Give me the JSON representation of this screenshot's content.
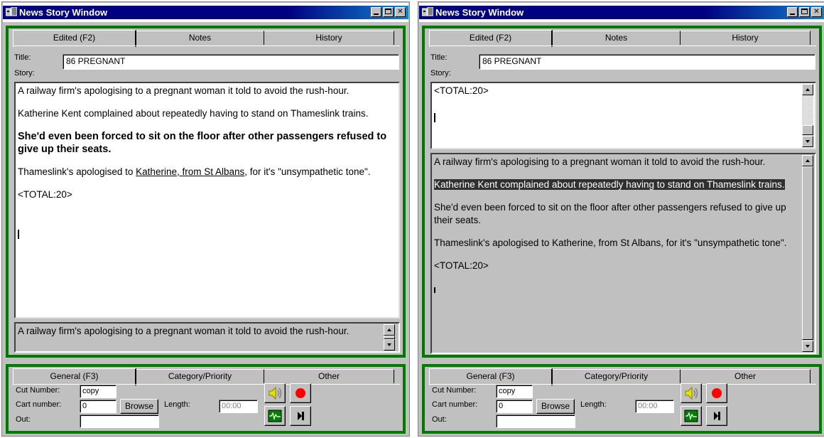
{
  "windows": [
    {
      "title": "News Story Window",
      "top_tabs": [
        "Edited (F2)",
        "Notes",
        "History"
      ],
      "title_label": "Title:",
      "title_value": "86 PREGNANT",
      "story_label": "Story:",
      "story": {
        "p1": "A railway firm's apologising to a pregnant woman it told to avoid the rush-hour.",
        "p2": "Katherine Kent complained about repeatedly having to stand on Thameslink trains.",
        "p3": "She'd even been forced to sit on the floor after other passengers refused to give up their seats.",
        "p4_pre": "Thameslink's apologised to ",
        "p4_link": "Katherine, from St Albans",
        "p4_post": ", for it's \"unsympathetic tone\".",
        "total": "<TOTAL:20>"
      },
      "preview": "A railway firm's apologising to a pregnant woman it told to avoid the rush-hour.",
      "bottom_tabs": [
        "General (F3)",
        "Category/Priority",
        "Other"
      ],
      "cut_number_label": "Cut Number:",
      "cut_number_value": "copy",
      "cart_number_label": "Cart number:",
      "cart_number_value": "0",
      "browse_label": "Browse",
      "length_label": "Length:",
      "length_value": "00:00",
      "out_label": "Out:"
    },
    {
      "title": "News Story Window",
      "top_tabs": [
        "Edited (F2)",
        "Notes",
        "History"
      ],
      "title_label": "Title:",
      "title_value": "86 PREGNANT",
      "story_label": "Story:",
      "editor_text": "<TOTAL:20>",
      "preview": {
        "p1": "A railway firm's apologising to a pregnant woman it told to avoid the rush-hour.",
        "p2": "Katherine Kent complained about repeatedly having to stand on Thameslink trains.",
        "p3": "She'd even been forced to sit on the floor after other passengers refused to give up their seats.",
        "p4": "Thameslink's apologised to Katherine, from St Albans, for it's \"unsympathetic tone\".",
        "total": "<TOTAL:20>"
      },
      "bottom_tabs": [
        "General (F3)",
        "Category/Priority",
        "Other"
      ],
      "cut_number_label": "Cut Number:",
      "cut_number_value": "copy",
      "cart_number_label": "Cart number:",
      "cart_number_value": "0",
      "browse_label": "Browse",
      "length_label": "Length:",
      "length_value": "00:00",
      "out_label": "Out:"
    }
  ],
  "icons": [
    "app-icon",
    "minimize-icon",
    "maximize-icon",
    "close-icon",
    "speaker-icon",
    "record-icon",
    "waveform-icon",
    "play-next-icon"
  ],
  "colors": {
    "panel_border": "#007a00",
    "titlebar": "#000080",
    "record": "#ff0000"
  }
}
